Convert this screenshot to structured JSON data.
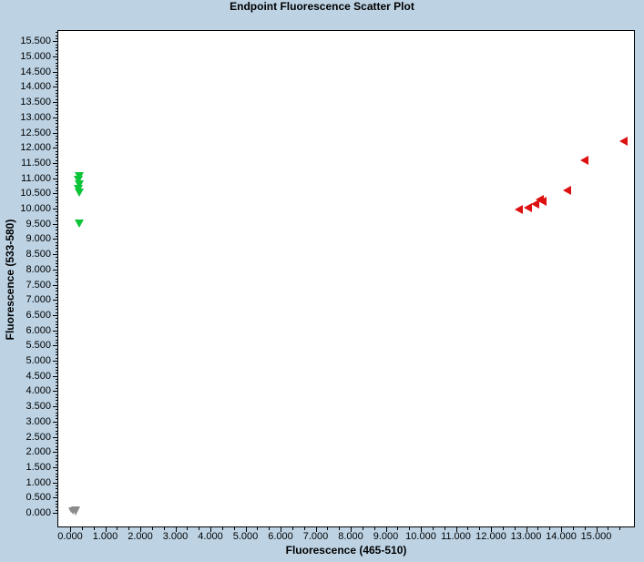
{
  "title": "Endpoint Fluorescence Scatter Plot",
  "colors": {
    "background": "#bdd3e4",
    "plot_background": "#ffffff",
    "plot_border": "#000000",
    "text": "#000000",
    "series_green": "#0cc438",
    "series_red": "#dd1111",
    "series_gray": "#8b8b8b"
  },
  "chart_data": {
    "type": "scatter",
    "title": "Endpoint Fluorescence Scatter Plot",
    "xlabel": "Fluorescence (465-510)",
    "ylabel": "Fluorescence (533-580)",
    "xlim": [
      -0.38,
      16.1
    ],
    "ylim": [
      -0.48,
      15.87
    ],
    "grid": false,
    "legend": "none",
    "x_tick_labels": [
      "0.000",
      "1.000",
      "2.000",
      "3.000",
      "4.000",
      "5.000",
      "6.000",
      "7.000",
      "8.000",
      "9.000",
      "10.000",
      "11.000",
      "12.000",
      "13.000",
      "14.000",
      "15.000"
    ],
    "y_tick_labels": [
      "0.000",
      "0.500",
      "1.000",
      "1.500",
      "2.000",
      "2.500",
      "3.000",
      "3.500",
      "4.000",
      "4.500",
      "5.000",
      "5.500",
      "6.000",
      "6.500",
      "7.000",
      "7.500",
      "8.000",
      "8.500",
      "9.000",
      "9.500",
      "10.000",
      "10.500",
      "11.000",
      "11.500",
      "12.000",
      "12.500",
      "13.000",
      "13.500",
      "14.000",
      "14.500",
      "15.000",
      "15.500"
    ],
    "x_minor_tick_step": 0.3333,
    "y_minor_tick_step": 0.1,
    "series": [
      {
        "name": "green-cluster",
        "marker": "triangle-down",
        "color": "#0cc438",
        "size": 10,
        "points": [
          [
            0.25,
            11.08
          ],
          [
            0.24,
            10.94
          ],
          [
            0.26,
            10.8
          ],
          [
            0.24,
            10.66
          ],
          [
            0.26,
            10.52
          ],
          [
            0.26,
            9.5
          ]
        ]
      },
      {
        "name": "red-cluster",
        "marker": "triangle-left",
        "color": "#dd1111",
        "size": 10,
        "points": [
          [
            15.79,
            12.22
          ],
          [
            14.65,
            11.59
          ],
          [
            14.16,
            10.6
          ],
          [
            13.48,
            10.24
          ],
          [
            13.38,
            10.3
          ],
          [
            13.27,
            10.15
          ],
          [
            13.06,
            10.03
          ],
          [
            12.78,
            9.97
          ]
        ]
      },
      {
        "name": "gray-cluster",
        "marker": "triangle-down",
        "color": "#8b8b8b",
        "size": 7,
        "points": [
          [
            0.05,
            0.1
          ],
          [
            0.12,
            0.13
          ],
          [
            0.19,
            0.08
          ],
          [
            0.08,
            0.02
          ],
          [
            0.16,
            0.01
          ],
          [
            0.23,
            0.11
          ]
        ]
      }
    ]
  }
}
